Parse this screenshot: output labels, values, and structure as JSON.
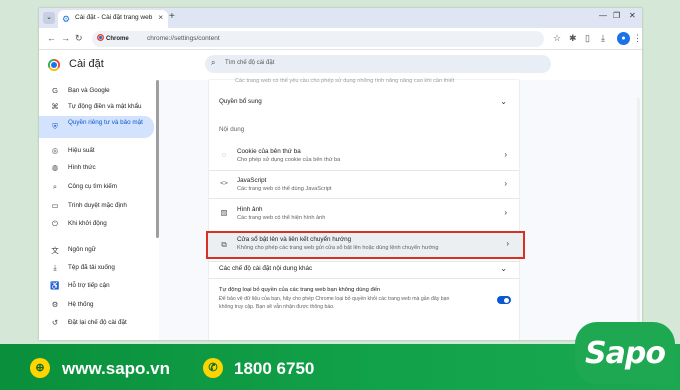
{
  "browser": {
    "tab_title": "Cài đặt - Cài đặt trang web",
    "tab_close": "×",
    "new_tab": "+",
    "chrome_chip": "Chrome",
    "url": "chrome://settings/content"
  },
  "settings": {
    "title": "Cài đặt",
    "search_placeholder": "Tìm chế độ cài đặt"
  },
  "sidebar": {
    "items": [
      {
        "label": "Bạn và Google",
        "icon": "G"
      },
      {
        "label": "Tự động điền và mật khẩu",
        "icon": "⌘"
      },
      {
        "label": "Quyền riêng tư và bảo mật",
        "icon": "⛨"
      },
      {
        "label": "Hiệu suất",
        "icon": "◎"
      },
      {
        "label": "Hình thức",
        "icon": "◍"
      },
      {
        "label": "Công cụ tìm kiếm",
        "icon": "⌕"
      },
      {
        "label": "Trình duyệt mặc định",
        "icon": "▭"
      },
      {
        "label": "Khi khởi động",
        "icon": "⏻"
      },
      {
        "label": "Ngôn ngữ",
        "icon": "文"
      },
      {
        "label": "Tệp đã tải xuống",
        "icon": "⤓"
      },
      {
        "label": "Hỗ trợ tiếp cận",
        "icon": "♿"
      },
      {
        "label": "Hệ thống",
        "icon": "⚙"
      },
      {
        "label": "Đặt lại chế độ cài đặt",
        "icon": "↺"
      }
    ]
  },
  "main": {
    "top_cut_text": "Các trang web có thể yêu cầu cho phép sử dụng những tính năng nâng cao khi cần thiết",
    "additional_permissions": "Quyền bổ sung",
    "content_heading": "Nội dung",
    "rows": [
      {
        "title": "Cookie của bên thứ ba",
        "subtitle": "Cho phép sử dụng cookie của bên thứ ba",
        "icon": "◌"
      },
      {
        "title": "JavaScript",
        "subtitle": "Các trang web có thể dùng JavaScript",
        "icon": "<>"
      },
      {
        "title": "Hình ảnh",
        "subtitle": "Các trang web có thể hiện hình ảnh",
        "icon": "▨"
      },
      {
        "title": "Cửa sổ bật lên và liên kết chuyển hướng",
        "subtitle": "Không cho phép các trang web gửi cửa sổ bật lên hoặc dùng lệnh chuyển hướng",
        "icon": "⧉"
      }
    ],
    "more_content_settings": "Các chế độ cài đặt nội dung khác",
    "auto_remove": {
      "title": "Tự động loại bỏ quyền của các trang web bạn không dùng đến",
      "desc_line1": "Để bảo vệ dữ liệu của bạn, hãy cho phép Chrome loại bỏ quyền khỏi các trang web mà gần đây bạn",
      "desc_line2": "không truy cập. Bạn sẽ vẫn nhận được thông báo.",
      "enabled": true
    }
  },
  "footer": {
    "website": "www.sapo.vn",
    "hotline": "1800 6750",
    "brand": "Sapo"
  },
  "colors": {
    "accent": "#0b57d0",
    "highlight_border": "#d93025",
    "footer_green": "#12a34a",
    "footer_icon": "#ffd400"
  }
}
